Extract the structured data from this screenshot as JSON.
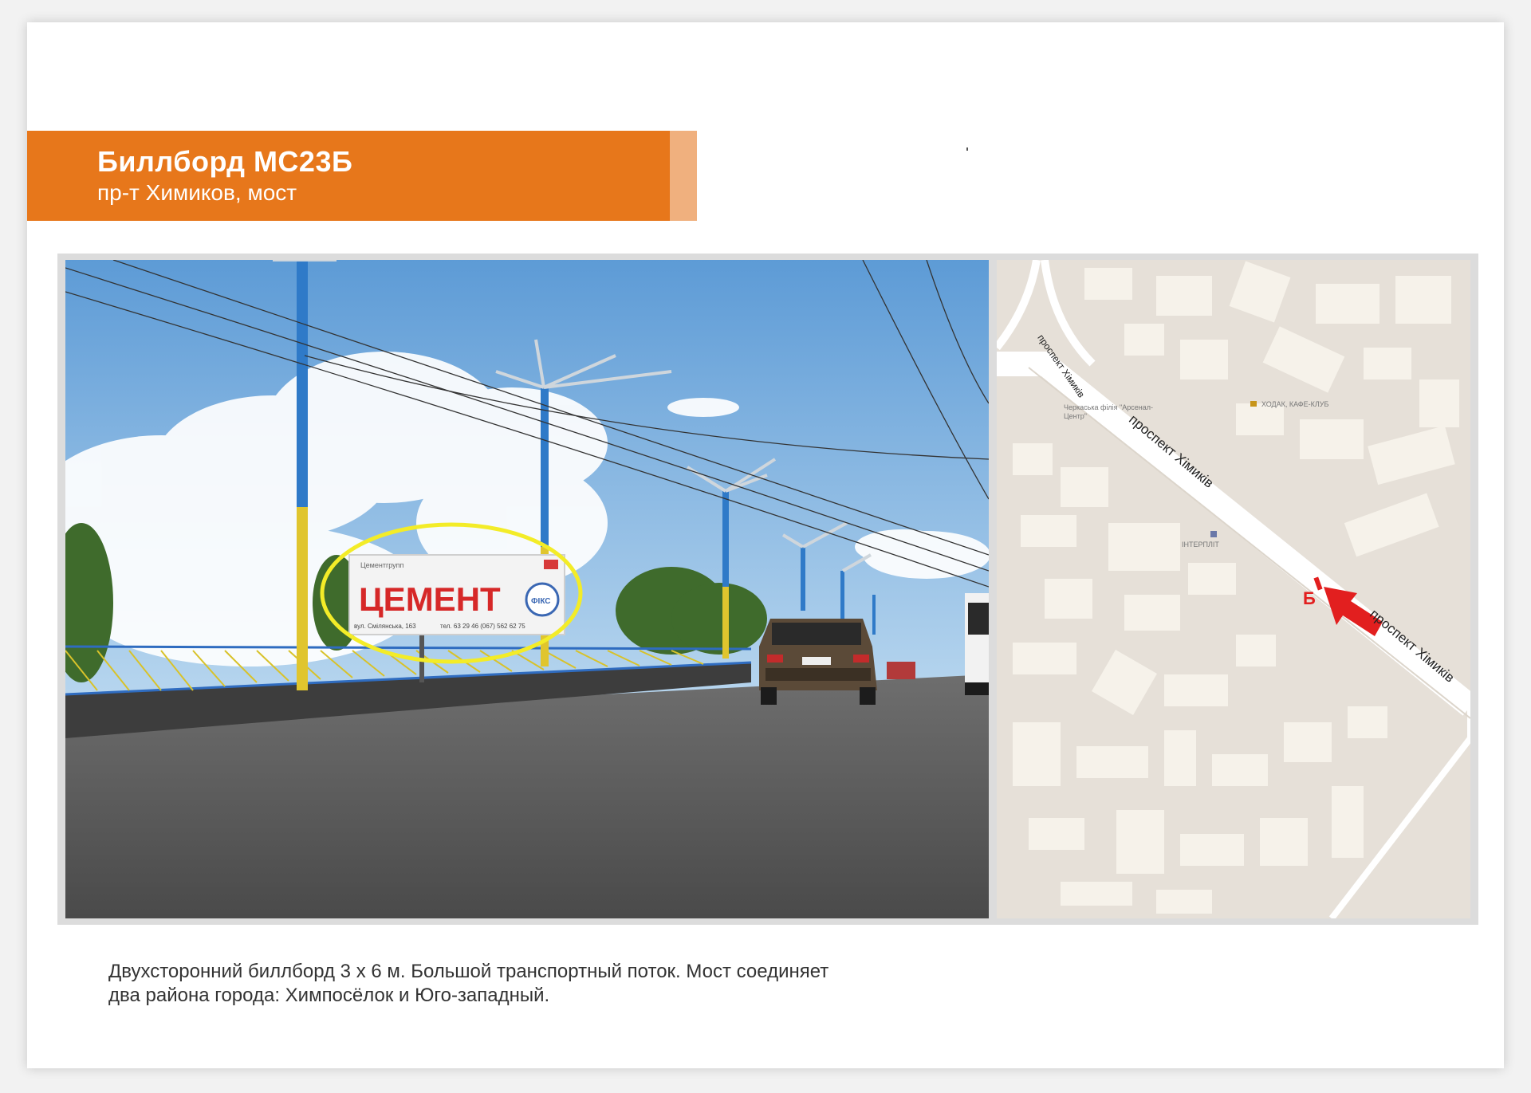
{
  "header": {
    "title": "Биллборд МС23Б",
    "subtitle": "пр-т Химиков, мост",
    "band_color": "#e7771b",
    "accent_color": "#f0b07e"
  },
  "photo": {
    "billboard": {
      "headline": "ЦЕМЕНТ",
      "brand": "Цементгрупп",
      "badge": "ФІКС",
      "address_line": "вул. Смілянська, 163",
      "phone_line": "тел. 63 29 46 (067) 562 62 75"
    },
    "highlight_color": "#f3ec28"
  },
  "map": {
    "street_label_1": "проспект Хімиків",
    "street_label_2": "проспект Хімиків",
    "street_label_3": "проспект Хімиків",
    "poi_1": "ХОДАК, КАФЕ-КЛУБ",
    "poi_2": "ІНТЕРПЛІТ",
    "poi_3": "Черкаська філія \"Арсенал-Центр\"",
    "marker_letter": "Б",
    "marker_color": "#e21f1f"
  },
  "description": {
    "line1": "Двухсторонний биллборд 3 х 6 м. Большой транспортный поток. Мост соединяет",
    "line2": "два района города: Химпосёлок и Юго-западный."
  }
}
